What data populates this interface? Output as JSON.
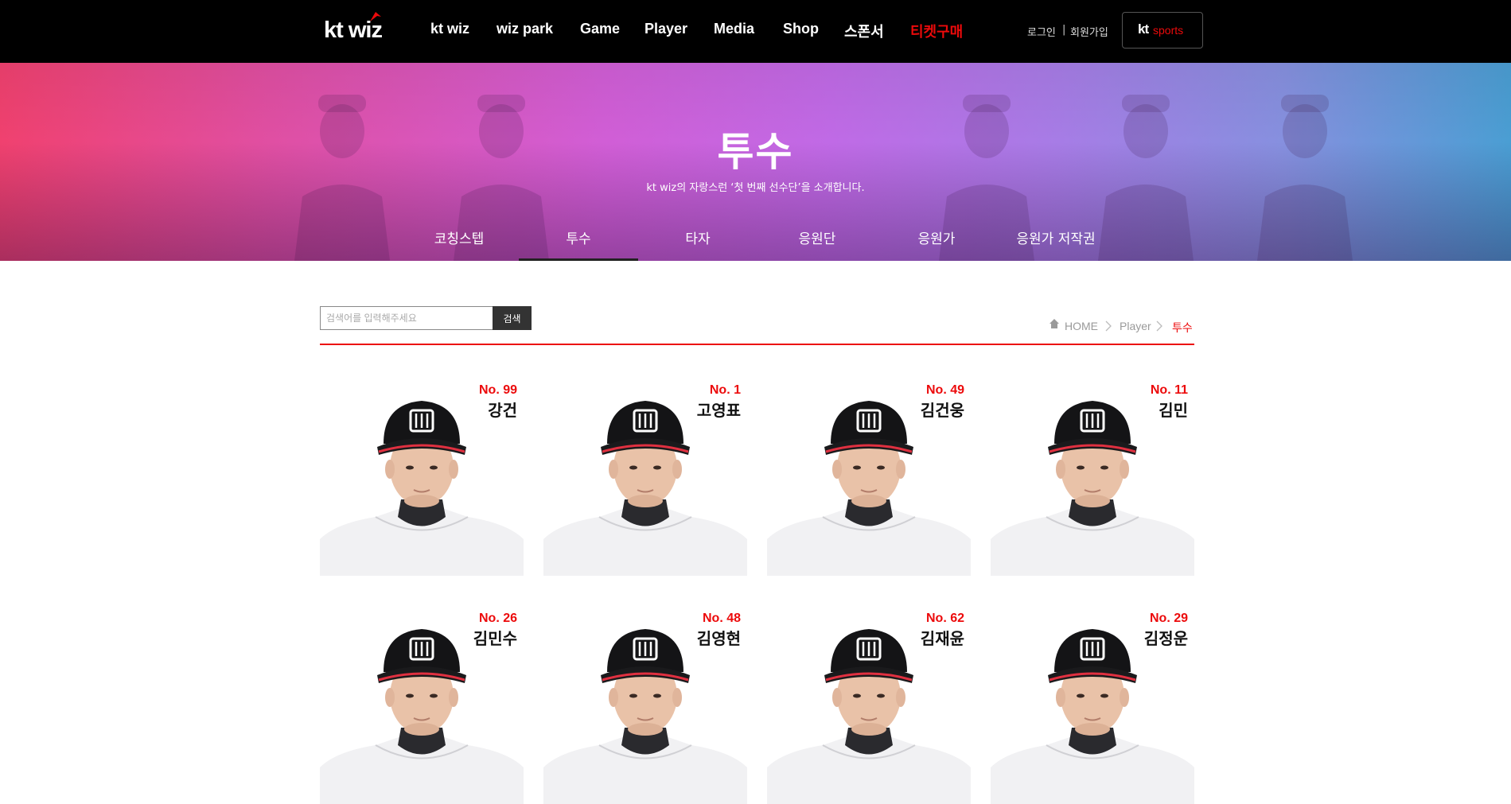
{
  "header": {
    "logo": "kt wiz",
    "nav": [
      {
        "label": "kt wiz"
      },
      {
        "label": "wiz park"
      },
      {
        "label": "Game"
      },
      {
        "label": "Player"
      },
      {
        "label": "Media"
      },
      {
        "label": "Shop"
      },
      {
        "label": "스폰서"
      },
      {
        "label": "티켓구매"
      }
    ],
    "login": "로그인",
    "separator": "|",
    "signup": "회원가입",
    "ktsports": {
      "kt": "kt",
      "sports": "sports"
    }
  },
  "hero": {
    "title": "투수",
    "subtitle": "kt wiz의 자랑스런 ‘첫 번째 선수단’을 소개합니다.",
    "tabs": [
      {
        "label": "코칭스텝"
      },
      {
        "label": "투수"
      },
      {
        "label": "타자"
      },
      {
        "label": "응원단"
      },
      {
        "label": "응원가"
      },
      {
        "label": "응원가 저작권"
      }
    ],
    "active_tab": "투수"
  },
  "search": {
    "placeholder": "검색어를 입력해주세요",
    "button": "검색"
  },
  "breadcrumb": {
    "home": "HOME",
    "level1": "Player",
    "current": "투수"
  },
  "players": [
    {
      "no": "No. 99",
      "name": "강건"
    },
    {
      "no": "No. 1",
      "name": "고영표"
    },
    {
      "no": "No. 49",
      "name": "김건웅"
    },
    {
      "no": "No. 11",
      "name": "김민"
    },
    {
      "no": "No. 26",
      "name": "김민수"
    },
    {
      "no": "No. 48",
      "name": "김영현"
    },
    {
      "no": "No. 62",
      "name": "김재윤"
    },
    {
      "no": "No. 29",
      "name": "김정운"
    }
  ],
  "colors": {
    "accent_red": "#ec0a0b",
    "topbar": "#000000",
    "hero_left": "#f0416f",
    "hero_mid": "#c06ae6",
    "hero_right": "#4a9ed3"
  }
}
